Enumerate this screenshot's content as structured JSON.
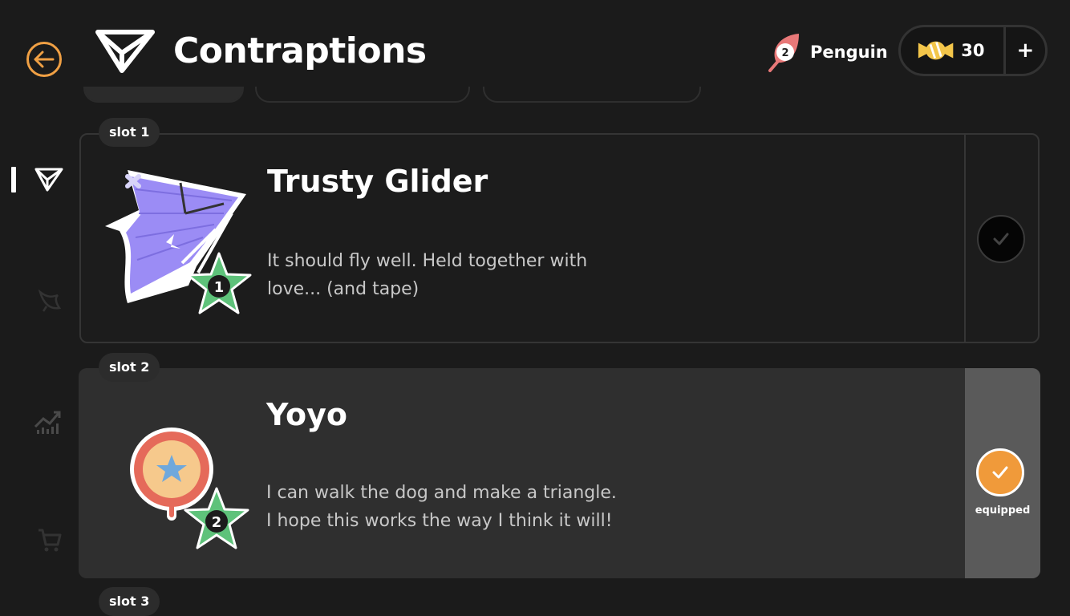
{
  "header": {
    "title": "Contraptions",
    "character": {
      "name": "Penguin",
      "level": "2"
    },
    "currency": {
      "count": "30",
      "add_label": "+"
    }
  },
  "sidebar": {
    "items": [
      {
        "name": "contraptions",
        "icon": "paper-plane-icon",
        "active": true
      },
      {
        "name": "birds",
        "icon": "bird-icon",
        "active": false
      },
      {
        "name": "stats",
        "icon": "chart-trend-icon",
        "active": false
      },
      {
        "name": "shop",
        "icon": "shopping-cart-icon",
        "active": false
      }
    ]
  },
  "slots": [
    {
      "label": "slot 1",
      "name": "Trusty Glider",
      "description": "It should fly well. Held together with love... (and tape)",
      "level": "1",
      "equipped": false
    },
    {
      "label": "slot 2",
      "name": "Yoyo",
      "description": "I can walk the dog and make a triangle. I hope this works the way I think it will!",
      "level": "2",
      "equipped": true,
      "equipped_label": "equipped"
    },
    {
      "label": "slot 3"
    }
  ],
  "colors": {
    "accent": "#f09a3a",
    "background": "#1b1b1b",
    "star": "#5ec27a",
    "glider": "#9b8cf5"
  }
}
